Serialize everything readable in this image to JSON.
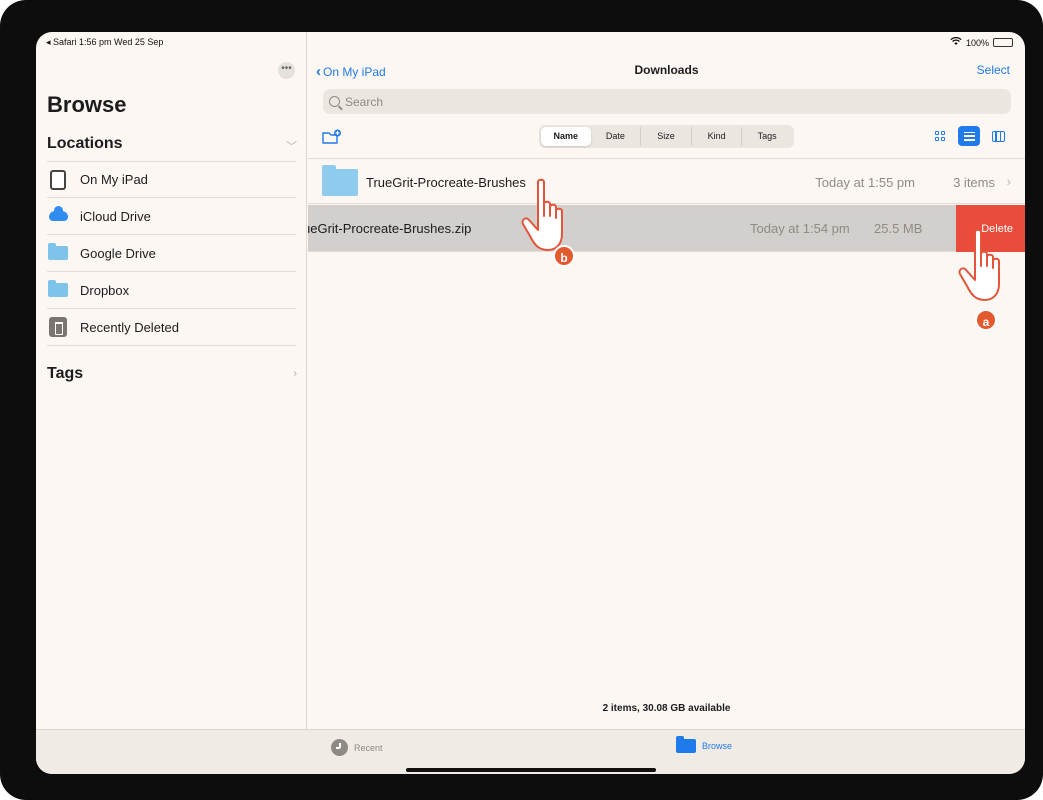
{
  "status_bar": {
    "left": "◂ Safari  1:56 pm  Wed 25 Sep",
    "battery": "100%"
  },
  "sidebar": {
    "title": "Browse",
    "locations_header": "Locations",
    "locations": [
      {
        "label": "On My iPad",
        "icon": "ipad-icon"
      },
      {
        "label": "iCloud Drive",
        "icon": "icloud-icon"
      },
      {
        "label": "Google Drive",
        "icon": "folder-icon"
      },
      {
        "label": "Dropbox",
        "icon": "folder-icon"
      },
      {
        "label": "Recently Deleted",
        "icon": "trash-icon"
      }
    ],
    "tags_header": "Tags"
  },
  "nav": {
    "back_label": "On My iPad",
    "title": "Downloads",
    "select_label": "Select"
  },
  "search": {
    "placeholder": "Search"
  },
  "sort": {
    "options": [
      "Name",
      "Date",
      "Size",
      "Kind",
      "Tags"
    ],
    "selected": "Name"
  },
  "files": [
    {
      "name": "TrueGrit-Procreate-Brushes",
      "date": "Today at 1:55 pm",
      "info": "3 items"
    },
    {
      "name": "ueGrit-Procreate-Brushes.zip",
      "date": "Today at 1:54 pm",
      "info": "25.5 MB",
      "swipe_action": "Delete"
    }
  ],
  "footer": "2 items, 30.08 GB available",
  "tabbar": {
    "recent": "Recent",
    "browse": "Browse"
  },
  "annotations": {
    "a": "a",
    "b": "b"
  },
  "colors": {
    "accent": "#1f7aea",
    "delete": "#ea4c3c",
    "badge": "#e35a2e",
    "hand": "#e2553a"
  }
}
